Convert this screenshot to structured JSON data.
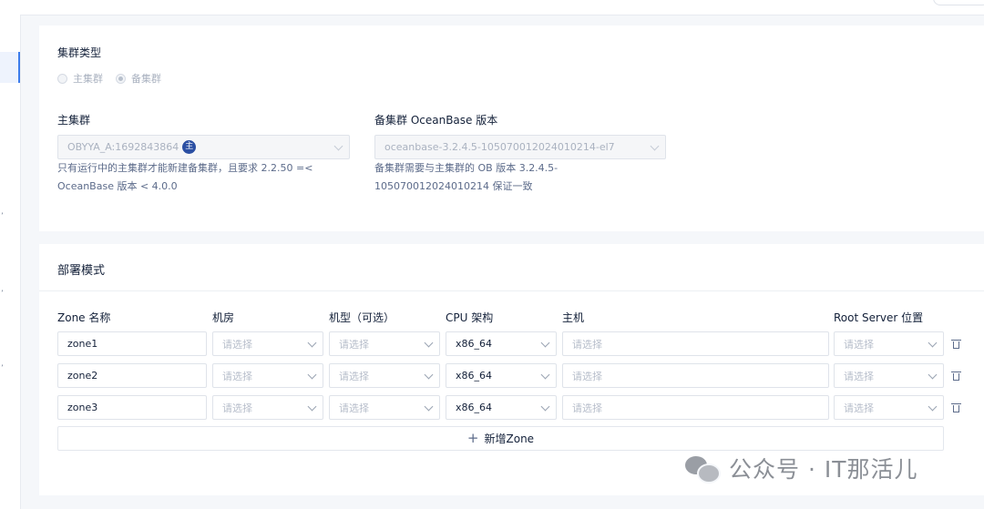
{
  "cluster_type": {
    "label": "集群类型",
    "options": [
      "主集群",
      "备集群"
    ],
    "selected": "备集群"
  },
  "primary_cluster": {
    "label": "主集群",
    "value": "OBYYA_A:1692843864",
    "badge": "主",
    "help": [
      "只有运行中的主集群才能新建备集群，且要求 2.2.50 =<",
      "OceanBase 版本 < 4.0.0"
    ]
  },
  "standby_version": {
    "label": "备集群 OceanBase 版本",
    "value": "oceanbase-3.2.4.5-105070012024010214-el7",
    "help": [
      "备集群需要与主集群的 OB 版本 3.2.4.5-",
      "105070012024010214 保证一致"
    ]
  },
  "deploy": {
    "title": "部署模式",
    "columns": [
      "Zone 名称",
      "机房",
      "机型（可选）",
      "CPU 架构",
      "主机",
      "Root Server 位置"
    ],
    "placeholder": "请选择",
    "rows": [
      {
        "zone": "zone1",
        "cpu": "x86_64"
      },
      {
        "zone": "zone2",
        "cpu": "x86_64"
      },
      {
        "zone": "zone3",
        "cpu": "x86_64"
      }
    ],
    "add_label": "新增Zone"
  },
  "watermark": "公众号 · IT那活儿",
  "icons": {
    "trash": "trash-icon",
    "chevron": "chevron-down-icon",
    "plus": "plus-icon"
  },
  "colors": {
    "accent": "#3d7dec",
    "badge": "#2b4fa3",
    "text": "#132039",
    "muted": "#5c6b8a"
  }
}
